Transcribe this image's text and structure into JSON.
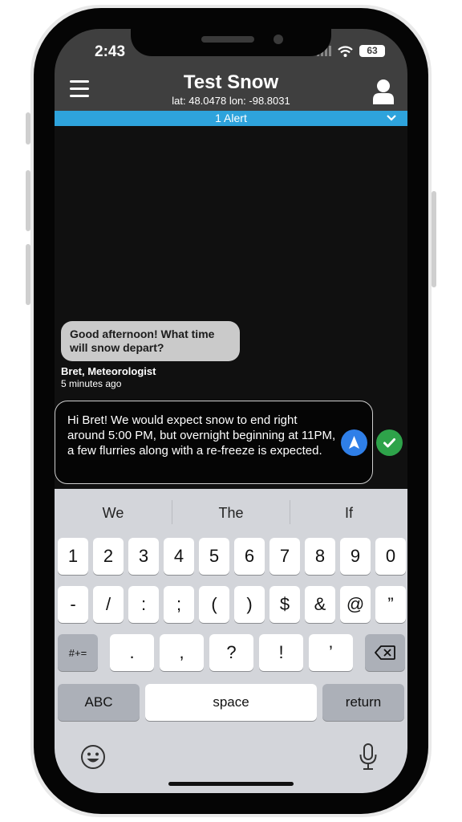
{
  "status": {
    "time": "2:43",
    "battery": "63"
  },
  "header": {
    "title": "Test Snow",
    "coordinates": "lat: 48.0478 lon: -98.8031"
  },
  "alert_bar": {
    "label": "1 Alert"
  },
  "chat": {
    "incoming": {
      "text": "Good afternoon! What time will snow depart?",
      "sender": "Bret, Meteorologist",
      "time_ago": "5 minutes ago"
    },
    "compose_text": "Hi Bret! We would expect snow to end right around 5:00 PM, but overnight beginning at 11PM, a few flurries along with a re-freeze is expected."
  },
  "keyboard": {
    "suggestions": [
      "We",
      "The",
      "If"
    ],
    "row1": [
      "1",
      "2",
      "3",
      "4",
      "5",
      "6",
      "7",
      "8",
      "9",
      "0"
    ],
    "row2": [
      "-",
      "/",
      ":",
      ";",
      "(",
      ")",
      "$",
      "&",
      "@",
      "”"
    ],
    "row3": [
      ".",
      ",",
      "?",
      "!",
      "’"
    ],
    "symbols_label": "#+=",
    "abc_label": "ABC",
    "space_label": "space",
    "return_label": "return"
  }
}
